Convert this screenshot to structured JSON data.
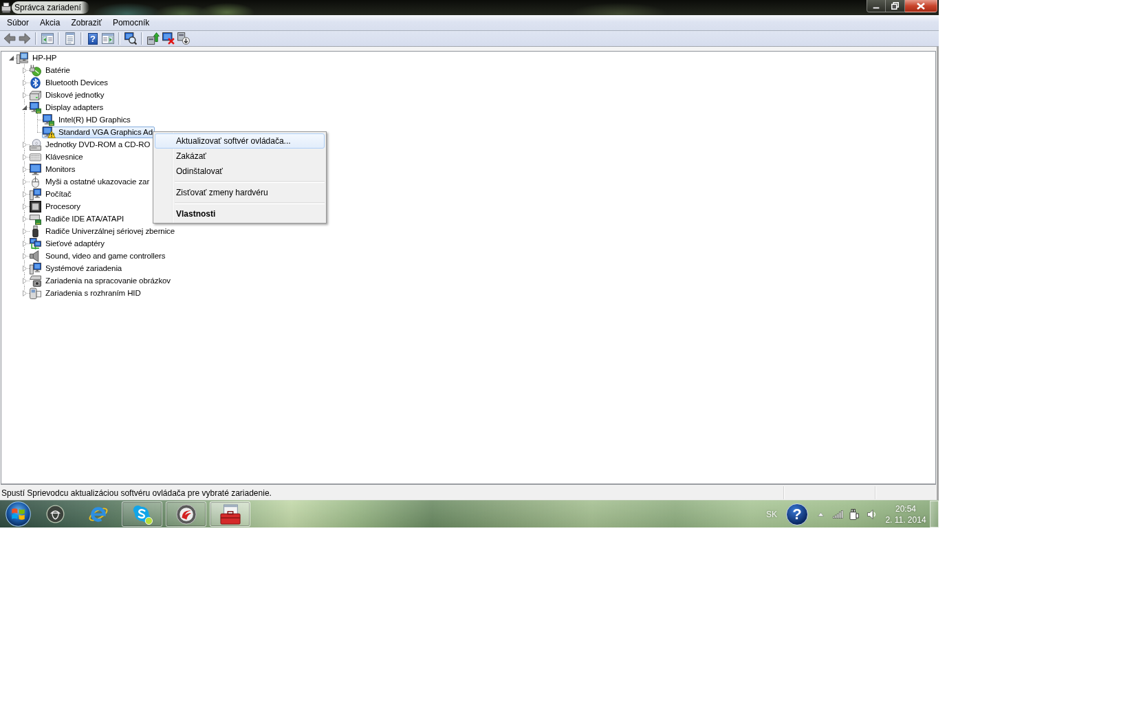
{
  "window": {
    "title": "Správca zariadení"
  },
  "menu_bar": [
    "Súbor",
    "Akcia",
    "Zobraziť",
    "Pomocník"
  ],
  "toolbar": {
    "groups": [
      [
        {
          "kind": "back",
          "disabled": true
        },
        {
          "kind": "forward",
          "disabled": true
        }
      ],
      [
        {
          "kind": "tree-pane",
          "disabled": false
        }
      ],
      [
        {
          "kind": "properties",
          "disabled": false
        }
      ],
      [
        {
          "kind": "help",
          "symbol": "?",
          "disabled": false
        },
        {
          "kind": "action-pane",
          "disabled": false
        }
      ],
      [
        {
          "kind": "scan",
          "disabled": false
        }
      ],
      [
        {
          "kind": "update-driver",
          "disabled": false
        },
        {
          "kind": "disable-device",
          "disabled": false
        },
        {
          "kind": "uninstall",
          "disabled": false
        }
      ]
    ]
  },
  "tree": {
    "label": "HP-HP",
    "kind": "computer",
    "expanded": true,
    "selected": false,
    "warning": false,
    "children": [
      {
        "label": "Batérie",
        "kind": "battery",
        "expanded": false,
        "selected": false,
        "warning": false
      },
      {
        "label": "Bluetooth Devices",
        "kind": "bluetooth",
        "expanded": false,
        "selected": false,
        "warning": false
      },
      {
        "label": "Diskové jednotky",
        "kind": "disk",
        "expanded": false,
        "selected": false,
        "warning": false
      },
      {
        "label": "Display adapters",
        "kind": "display",
        "expanded": true,
        "selected": false,
        "warning": false,
        "children": [
          {
            "label": "Intel(R) HD Graphics",
            "kind": "display",
            "selected": false,
            "warning": false
          },
          {
            "label": "Standard VGA Graphics Ad",
            "kind": "display",
            "selected": true,
            "warning": true
          }
        ]
      },
      {
        "label": "Jednotky DVD-ROM a CD-RO",
        "kind": "dvd",
        "expanded": false,
        "selected": false,
        "warning": false
      },
      {
        "label": "Klávesnice",
        "kind": "keyboard",
        "expanded": false,
        "selected": false,
        "warning": false
      },
      {
        "label": "Monitors",
        "kind": "monitor",
        "expanded": false,
        "selected": false,
        "warning": false
      },
      {
        "label": "Myši a ostatné ukazovacie zar",
        "kind": "mouse",
        "expanded": false,
        "selected": false,
        "warning": false
      },
      {
        "label": "Počítač",
        "kind": "pc",
        "expanded": false,
        "selected": false,
        "warning": false
      },
      {
        "label": "Procesory",
        "kind": "cpu",
        "expanded": false,
        "selected": false,
        "warning": false
      },
      {
        "label": "Radiče IDE ATA/ATAPI",
        "kind": "ide",
        "expanded": false,
        "selected": false,
        "warning": false
      },
      {
        "label": "Radiče Univerzálnej sériovej zbernice",
        "kind": "usb",
        "expanded": false,
        "selected": false,
        "warning": false
      },
      {
        "label": "Sieťové adaptéry",
        "kind": "network",
        "expanded": false,
        "selected": false,
        "warning": false
      },
      {
        "label": "Sound, video and game controllers",
        "kind": "sound",
        "expanded": false,
        "selected": false,
        "warning": false
      },
      {
        "label": "Systémové zariadenia",
        "kind": "pc",
        "expanded": false,
        "selected": false,
        "warning": false
      },
      {
        "label": "Zariadenia na spracovanie obrázkov",
        "kind": "imaging",
        "expanded": false,
        "selected": false,
        "warning": false
      },
      {
        "label": "Zariadenia s rozhraním HID",
        "kind": "hid",
        "expanded": false,
        "selected": false,
        "warning": false
      }
    ]
  },
  "context_menu": {
    "items": [
      {
        "kind": "item",
        "label": "Aktualizovať softvér ovládača...",
        "selected": true,
        "default": false
      },
      {
        "kind": "item",
        "label": "Zakázať",
        "selected": false,
        "default": false
      },
      {
        "kind": "item",
        "label": "Odinštalovať",
        "selected": false,
        "default": false
      },
      {
        "kind": "separator"
      },
      {
        "kind": "item",
        "label": "Zisťovať zmeny hardvéru",
        "selected": false,
        "default": false
      },
      {
        "kind": "separator"
      },
      {
        "kind": "item",
        "label": "Vlastnosti",
        "selected": false,
        "default": true
      }
    ]
  },
  "status_bar": {
    "text": "Spustí Sprievodcu aktualizáciou softvéru ovládača pre vybraté zariadenie."
  },
  "taskbar": {
    "apps": [
      {
        "kind": "acorn",
        "running": false,
        "active": false
      },
      {
        "kind": "browser",
        "running": false,
        "active": false
      },
      {
        "kind": "chat",
        "running": true,
        "active": false
      },
      {
        "kind": "swirl",
        "running": true,
        "active": false
      },
      {
        "kind": "toolbox",
        "running": true,
        "active": true
      }
    ],
    "tray": {
      "language": "SK",
      "help": "?",
      "time": "20:54",
      "date": "2. 11. 2014"
    }
  }
}
